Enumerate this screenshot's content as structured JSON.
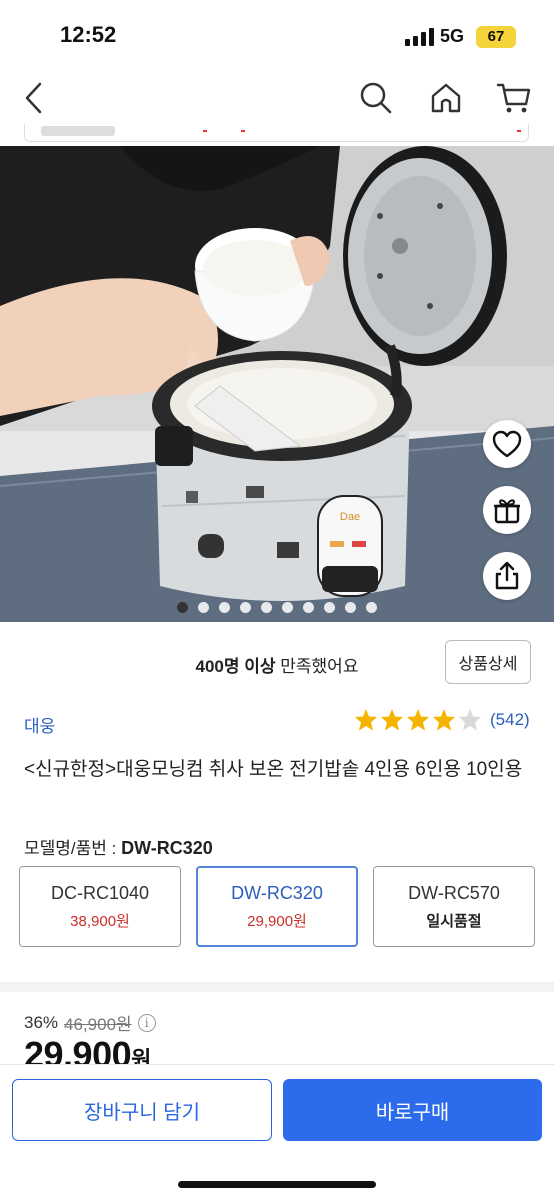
{
  "status_bar": {
    "time": "12:52",
    "network": "5G",
    "battery": "67"
  },
  "nav": {
    "back_icon": "chevron-left-icon",
    "search_icon": "search-icon",
    "home_icon": "home-icon",
    "cart_icon": "cart-icon"
  },
  "gallery": {
    "image_count": 10,
    "active_index": 0
  },
  "side_actions": [
    "heart-icon",
    "gift-icon",
    "share-icon"
  ],
  "satisfaction": {
    "count_text": "400명 이상",
    "suffix": " 만족했어요"
  },
  "detail_button": "상품상세",
  "brand": "대웅",
  "rating": {
    "stars": 4,
    "count": "(542)"
  },
  "title": "<신규한정>대웅모닝컴 취사 보온 전기밥솥 4인용 6인용 10인용",
  "model": {
    "label": "모델명/품번 : ",
    "value": "DW-RC320"
  },
  "options": [
    {
      "name": "DC-RC1040",
      "price": "38,900원",
      "selected": false,
      "sold_out": false
    },
    {
      "name": "DW-RC320",
      "price": "29,900원",
      "selected": true,
      "sold_out": false
    },
    {
      "name": "DW-RC570",
      "price": "일시품절",
      "selected": false,
      "sold_out": true
    }
  ],
  "price": {
    "discount": "36%",
    "original": "46,900원",
    "final_number": "29,900",
    "final_unit": "원"
  },
  "buttons": {
    "cart": "장바구니 담기",
    "buy": "바로구매"
  },
  "colors": {
    "accent": "#2b6bec",
    "brand_text": "#2a5ebd",
    "price_red": "#c9302c",
    "star": "#f5b400"
  }
}
